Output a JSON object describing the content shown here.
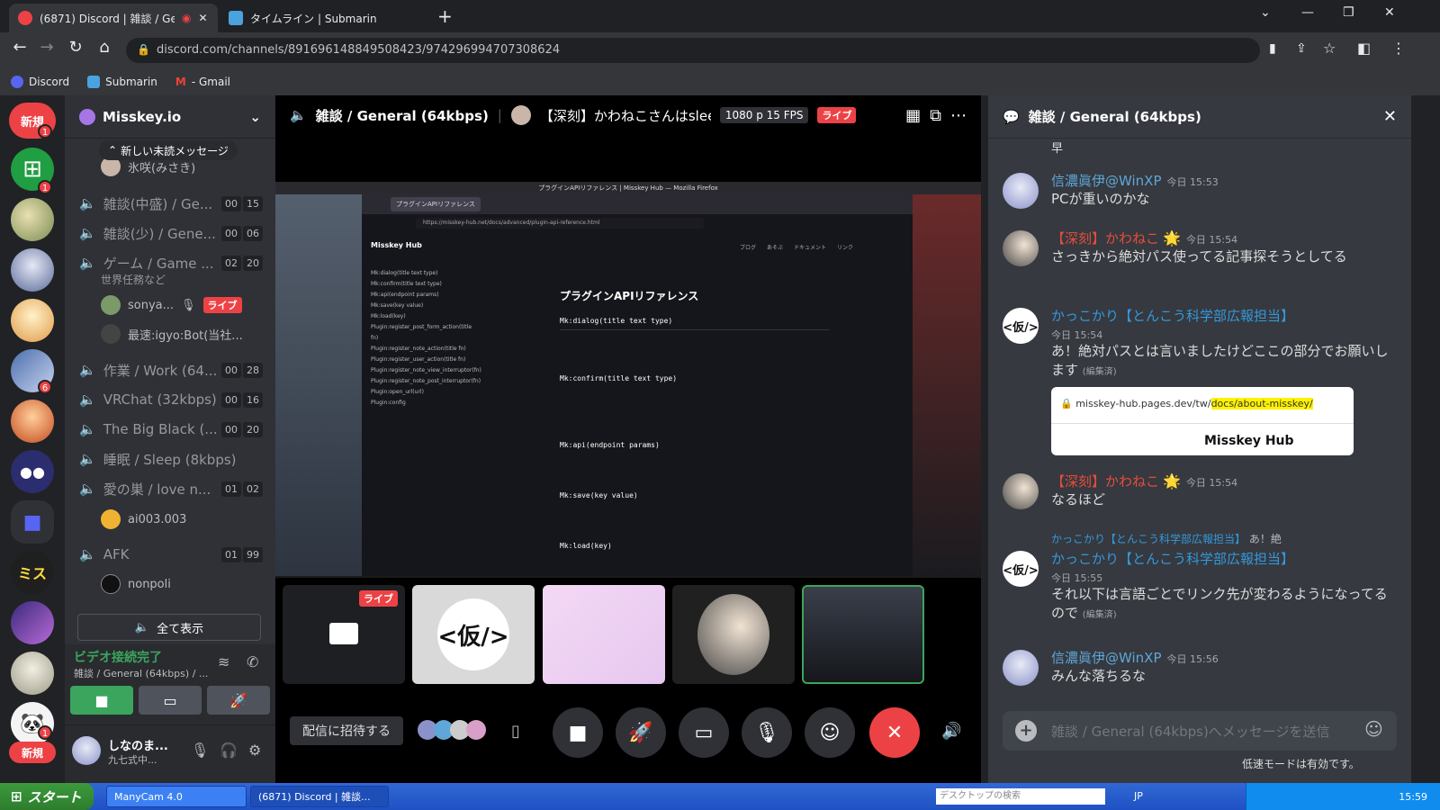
{
  "browser": {
    "tabs": [
      {
        "title": "(6871) Discord | 雑談 / Gene",
        "active": true
      },
      {
        "title": "タイムライン | Submarin",
        "active": false
      }
    ],
    "url": "discord.com/channels/891696148849508423/974296994707308624",
    "bookmarks": [
      "Discord",
      "Submarin",
      "- Gmail"
    ]
  },
  "servers": {
    "new_badge_top": "新規",
    "new_badge_bottom": "新規",
    "items": [
      {
        "badge": "1"
      },
      {
        "badge": "1"
      },
      {
        "badge": ""
      },
      {
        "badge": ""
      },
      {
        "badge": ""
      },
      {
        "badge": "6"
      },
      {
        "badge": ""
      },
      {
        "badge": ""
      },
      {
        "badge": ""
      },
      {
        "badge": ""
      },
      {
        "badge": ""
      },
      {
        "badge": ""
      },
      {
        "badge": "1"
      }
    ]
  },
  "channels": {
    "guild_name": "Misskey.io",
    "new_unread": "新しい未読メッセージ",
    "pinned_user": "氷咲(みさき)",
    "list": [
      {
        "name": "雑談(中盛) / Ge...",
        "c1": "00",
        "c2": "15"
      },
      {
        "name": "雑談(少) / Gene...",
        "c1": "00",
        "c2": "06"
      },
      {
        "name": "ゲーム / Game ...",
        "c1": "02",
        "c2": "20",
        "sub": "世界任務など"
      },
      {
        "name": "作業 / Work (64...",
        "c1": "00",
        "c2": "28"
      },
      {
        "name": "VRChat (32kbps)",
        "c1": "00",
        "c2": "16"
      },
      {
        "name": "The Big Black (...",
        "c1": "00",
        "c2": "20"
      },
      {
        "name": "睡眠 / Sleep (8kbps)",
        "c1": "",
        "c2": ""
      },
      {
        "name": "愛の巣 / love n...",
        "c1": "01",
        "c2": "02"
      },
      {
        "name": "AFK",
        "c1": "01",
        "c2": "99"
      }
    ],
    "users": {
      "sonya": "sonya...",
      "sonya_live": "ライブ",
      "igyo": "最速:igyo:Bot(当社...",
      "ai": "ai003.003",
      "nonpoli": "nonpoli"
    },
    "show_all": "全て表示"
  },
  "voice": {
    "status": "ビデオ接続完了",
    "channel": "雑談 / General (64kbps) / ..."
  },
  "me": {
    "name": "しなのま...",
    "status": "九七式中..."
  },
  "stage": {
    "channel": "雑談 / General (64kbps)",
    "stream_title": "【深刻】かわねこさんはslee",
    "quality": "1080 p 15 FPS",
    "live": "ライブ",
    "invite": "配信に招待する",
    "tile_live": "ライブ",
    "tile_kari": "<仮/>"
  },
  "screen": {
    "window_title": "プラグインAPIリファレンス | Misskey Hub — Mozilla Firefox",
    "tab_title": "プラグインAPIリファレンス",
    "url": "https://misskey-hub.net/docs/advanced/plugin-api-reference.html",
    "site": "Misskey Hub",
    "nav": [
      "ブログ",
      "あそぶ",
      "ドキュメント",
      "リンク"
    ],
    "heading": "プラグインAPIリファレンス",
    "sections": [
      "Mk:dialog(title text type)",
      "Mk:confirm(title text type)",
      "Mk:api(endpoint params)",
      "Mk:save(key value)",
      "Mk:load(key)"
    ],
    "toc": [
      "Mk:dialog(title text type)",
      "Mk:confirm(title text type)",
      "Mk:api(endpoint params)",
      "Mk:save(key value)",
      "Mk:load(key)",
      "Plugin:register_post_form_action(title fn)",
      "Plugin:register_note_action(title fn)",
      "Plugin:register_user_action(title fn)",
      "Plugin:register_note_view_interruptor(fn)",
      "Plugin:register_note_post_interruptor(fn)",
      "Plugin:open_url(url)",
      "Plugin:config"
    ]
  },
  "chat": {
    "title": "雑談 / General (64kbps)",
    "top_fragment": "早",
    "messages": [
      {
        "author": "信濃眞伊@WinXP",
        "time": "今日 15:53",
        "text": "PCが重いのかな",
        "color": "#5ea7d8"
      },
      {
        "author": "【深刻】かわねこ",
        "time": "今日 15:54",
        "text": "さっきから絶対パス使ってる記事探そうとしてる",
        "color": "#e74c3c"
      },
      {
        "author": "かっこかり【とんこう科学部広報担当】",
        "time": "今日 15:54",
        "text": "あ！絶対パスとは言いましたけどここの部分でお願いします",
        "edited": "(編集済)",
        "color": "#3498db"
      },
      {
        "author": "【深刻】かわねこ",
        "time": "今日 15:54",
        "text": "なるほど",
        "color": "#e74c3c"
      },
      {
        "author": "かっこかり【とんこう科学部広報担当】",
        "time": "今日 15:55",
        "text": "それ以下は言語ごとでリンク先が変わるようになってるので",
        "edited": "(編集済)",
        "color": "#3498db",
        "reply": "かっこかり【とんこう科学部広報担当】",
        "reply_text": "あ！絶"
      },
      {
        "author": "信濃眞伊@WinXP",
        "time": "今日 15:56",
        "text": "みんな落ちるな",
        "color": "#5ea7d8"
      }
    ],
    "embed_url_pre": "misskey-hub.pages.dev/tw/",
    "embed_url_hl": "docs/about-misskey/",
    "embed_brand": "Misskey Hub",
    "placeholder": "雑談 / General (64kbps)へメッセージを送信",
    "slowmode": "低速モードは有効です。"
  },
  "taskbar": {
    "start": "スタート",
    "items": [
      "ManyCam 4.0",
      "(6871) Discord | 雑談..."
    ],
    "search": "デスクトップの検索",
    "ime": "JP",
    "clock": "15:59"
  }
}
